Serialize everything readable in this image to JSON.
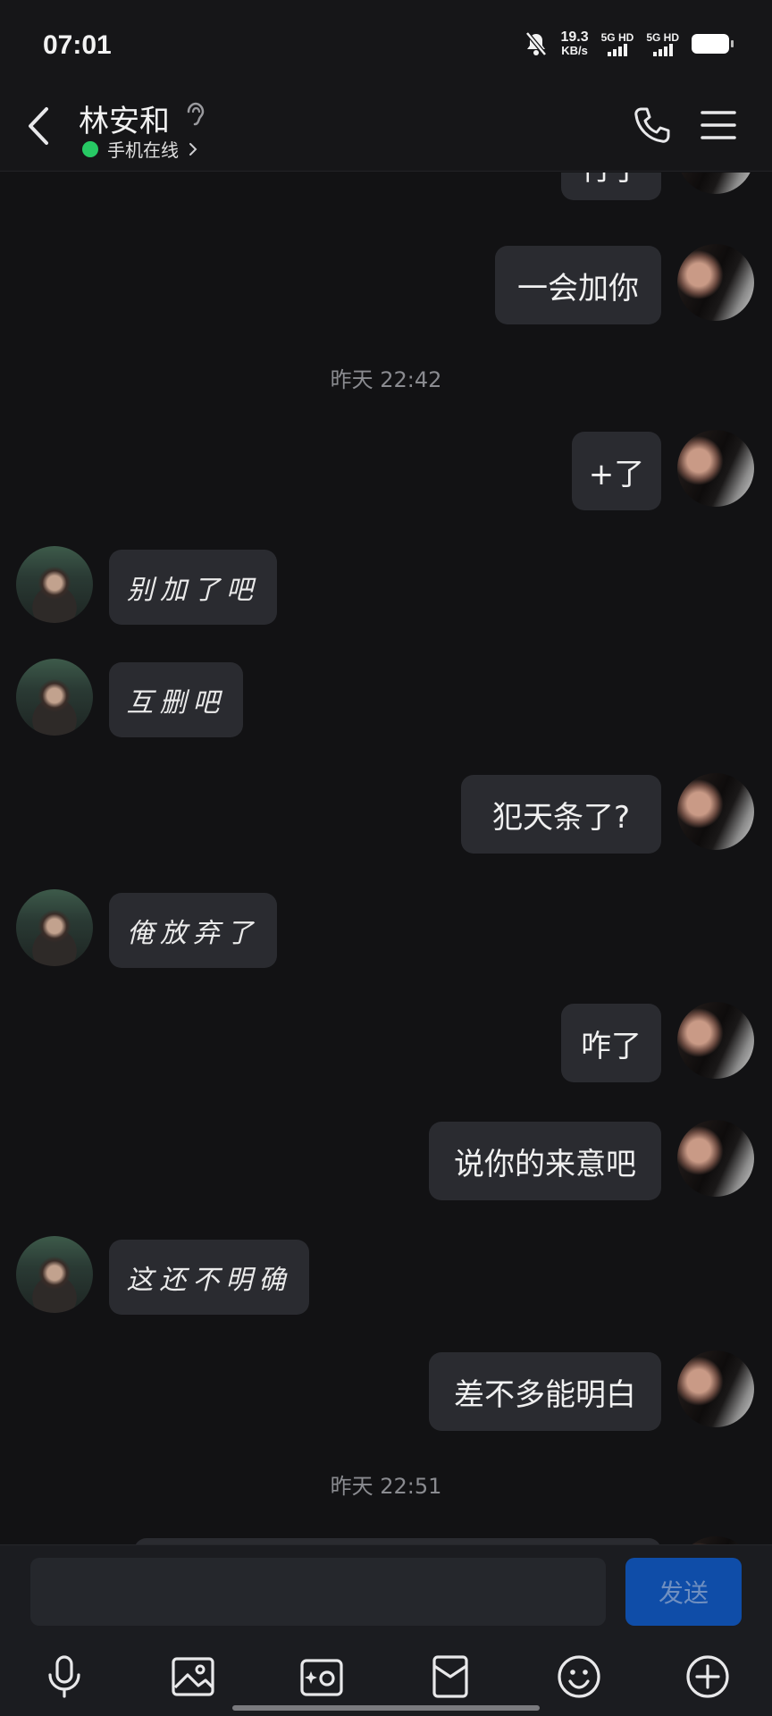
{
  "status_bar": {
    "time": "07:01",
    "net_speed_value": "19.3",
    "net_speed_unit": "KB/s",
    "sim1_label": "5G HD",
    "sim2_label": "5G HD",
    "icons": [
      "bell-muted-icon",
      "signal-icon",
      "battery-icon"
    ]
  },
  "header": {
    "contact_name": "林安和",
    "online_status": "手机在线",
    "icons": [
      "back-icon",
      "ear-icon",
      "phone-icon",
      "menu-icon"
    ]
  },
  "messages": [
    {
      "side": "right",
      "type": "text",
      "text": "行了"
    },
    {
      "side": "right",
      "type": "text",
      "text": "一会加你"
    },
    {
      "type": "timestamp",
      "text": "昨天 22:42"
    },
    {
      "side": "right",
      "type": "text",
      "text": "+了"
    },
    {
      "side": "left",
      "type": "text",
      "text": "别加了吧"
    },
    {
      "side": "left",
      "type": "text",
      "text": "互删吧"
    },
    {
      "side": "right",
      "type": "text",
      "text": "犯天条了?"
    },
    {
      "side": "left",
      "type": "text",
      "text": "俺放弃了"
    },
    {
      "side": "right",
      "type": "text",
      "text": "咋了"
    },
    {
      "side": "right",
      "type": "text",
      "text": "说你的来意吧"
    },
    {
      "side": "left",
      "type": "text",
      "text": "这还不明确"
    },
    {
      "side": "right",
      "type": "text",
      "text": "差不多能明白"
    },
    {
      "type": "timestamp",
      "text": "昨天 22:51"
    }
  ],
  "composer": {
    "input_value": "",
    "send_label": "发送"
  },
  "toolbar": {
    "items": [
      "voice-icon",
      "image-icon",
      "camera-icon",
      "red-packet-icon",
      "emoji-icon",
      "more-plus-icon"
    ]
  },
  "colors": {
    "background": "#121214",
    "bubble": "#2a2b30",
    "online": "#27c964",
    "send_button": "#0f4da8"
  }
}
